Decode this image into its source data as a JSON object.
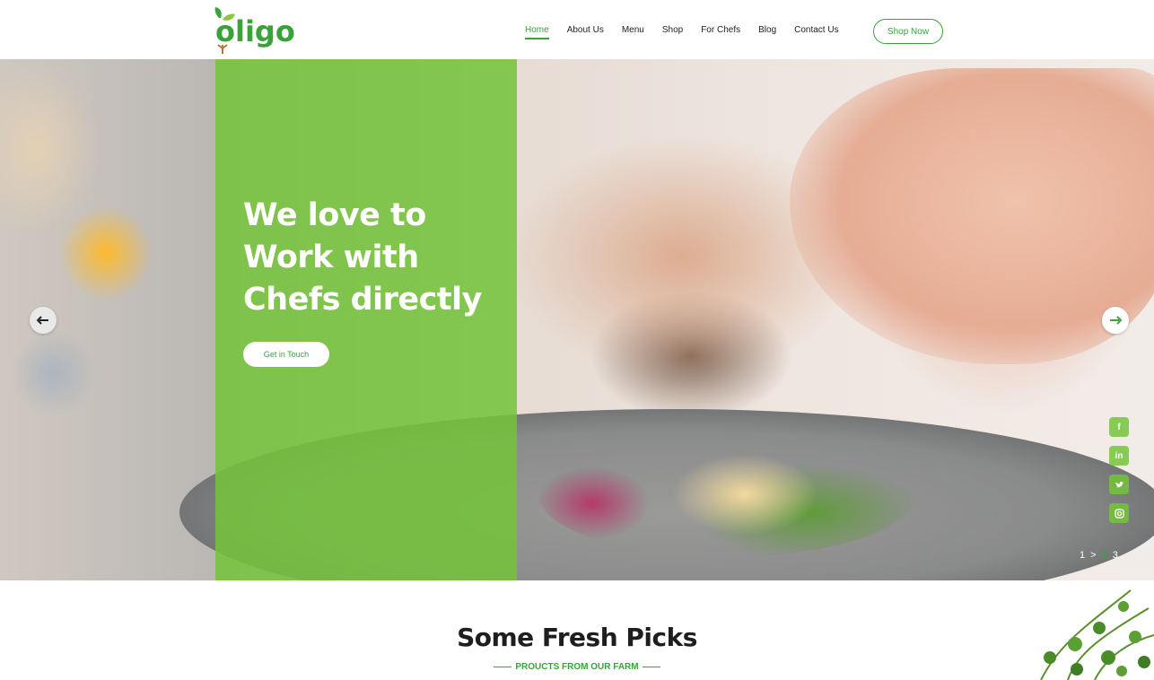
{
  "brand": {
    "name": "oligo",
    "primary_color": "#39a33a",
    "panel_color": "#74c43a"
  },
  "nav": {
    "items": [
      "Home",
      "About Us",
      "Menu",
      "Shop",
      "For Chefs",
      "Blog",
      "Contact Us"
    ],
    "active": "Home",
    "cta": "Shop Now"
  },
  "hero": {
    "title_lines": [
      "We love to",
      "Work with",
      "Chefs directly"
    ],
    "button": "Get in Touch",
    "social": [
      "facebook",
      "linkedin",
      "twitter",
      "instagram"
    ],
    "pager": {
      "first": "1",
      "separator": ">",
      "current": "2",
      "last": "3"
    }
  },
  "section": {
    "title": "Some Fresh Picks",
    "subtitle": "PROUCTS FROM OUR FARM"
  }
}
